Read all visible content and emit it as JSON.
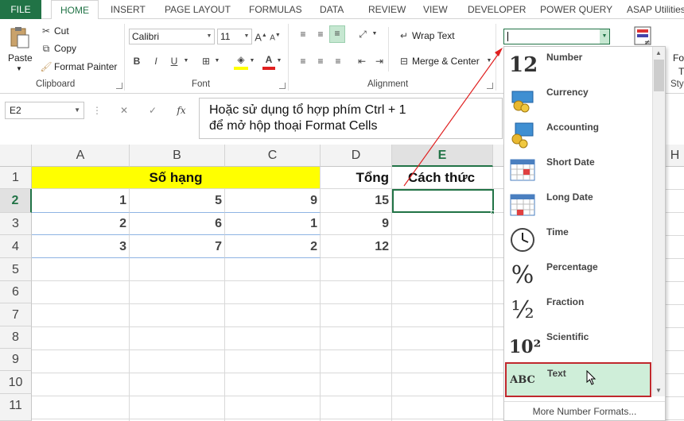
{
  "tabs": [
    "FILE",
    "HOME",
    "INSERT",
    "PAGE LAYOUT",
    "FORMULAS",
    "DATA",
    "REVIEW",
    "VIEW",
    "DEVELOPER",
    "POWER QUERY",
    "ASAP Utilities"
  ],
  "clipboard": {
    "paste": "Paste",
    "cut": "Cut",
    "copy": "Copy",
    "format_painter": "Format Painter",
    "label": "Clipboard"
  },
  "font": {
    "name": "Calibri",
    "size": "11",
    "label": "Font"
  },
  "alignment": {
    "wrap": "Wrap Text",
    "merge": "Merge & Center",
    "label": "Alignment"
  },
  "format_combo": {
    "value": ""
  },
  "right_partial": {
    "fo": "Fo",
    "t": "T",
    "sty": "Sty"
  },
  "formula_bar": {
    "name_box": "E2",
    "fx": "fx",
    "note_line1": "Hoặc sử dụng tổ hợp phím Ctrl + 1",
    "note_line2": "để mở hộp thoại Format Cells"
  },
  "columns": [
    "A",
    "B",
    "C",
    "D",
    "E"
  ],
  "col_h": "H",
  "rows": [
    "1",
    "2",
    "3",
    "4",
    "5",
    "6",
    "7",
    "8",
    "9",
    "10",
    "11"
  ],
  "cells": {
    "merged_header": "Số hạng",
    "d1": "Tổng",
    "e1": "Cách thức",
    "r2": [
      "1",
      "5",
      "9",
      "15"
    ],
    "r3": [
      "2",
      "6",
      "1",
      "9"
    ],
    "r4": [
      "3",
      "7",
      "2",
      "12"
    ]
  },
  "dropdown": {
    "items": [
      {
        "label": "Number",
        "icon": "12"
      },
      {
        "label": "Currency",
        "icon": "currency-icon"
      },
      {
        "label": "Accounting",
        "icon": "accounting-icon"
      },
      {
        "label": "Short Date",
        "icon": "calendar-icon"
      },
      {
        "label": "Long Date",
        "icon": "calendar-icon"
      },
      {
        "label": "Time",
        "icon": "clock-icon"
      },
      {
        "label": "Percentage",
        "icon": "%"
      },
      {
        "label": "Fraction",
        "icon": "½"
      },
      {
        "label": "Scientific",
        "icon": "10²"
      },
      {
        "label": "Text",
        "icon": "ABC"
      }
    ],
    "more": "More Number Formats...",
    "selected": "Text"
  },
  "colors": {
    "accent": "#217346",
    "highlight_yellow": "#ffff00",
    "selected_item": "#cfeed9",
    "red_border": "#c0282d"
  }
}
